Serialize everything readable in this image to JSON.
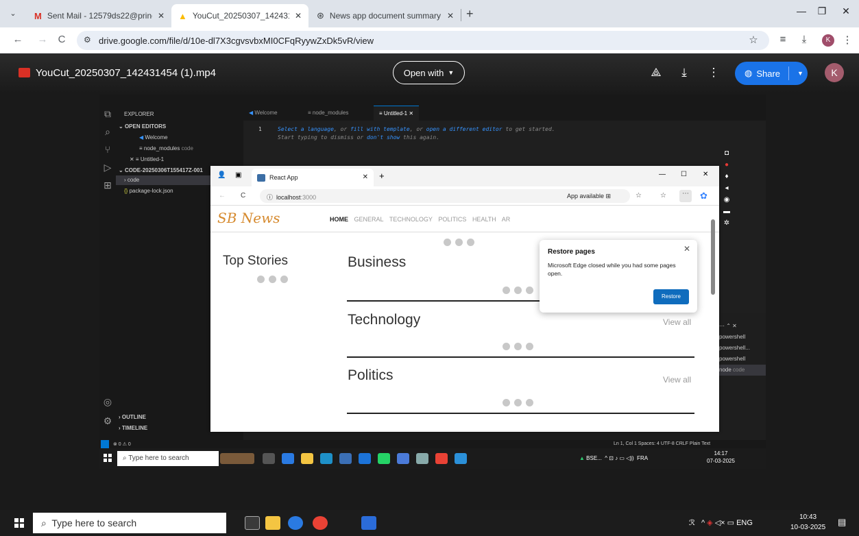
{
  "browser": {
    "tabs": [
      {
        "title": "Sent Mail - 12579ds22@princet",
        "active": false
      },
      {
        "title": "YouCut_20250307_142431454 (",
        "active": true
      },
      {
        "title": "News app document summary",
        "active": false
      }
    ],
    "url": "drive.google.com/file/d/10e-dl7X3cgvsvbxMI0CFqRyywZxDk5vR/view",
    "profile_initial": "K"
  },
  "drive": {
    "file_name": "YouCut_20250307_142431454 (1).mp4",
    "open_with_label": "Open with",
    "share_label": "Share",
    "avatar_initial": "K"
  },
  "vscode": {
    "explorer_title": "EXPLORER",
    "open_editors": "OPEN EDITORS",
    "open_editor_items": [
      "Welcome",
      "node_modules",
      "Untitled-1"
    ],
    "node_modules_suffix": "code",
    "folder": "CODE-20250306T155417Z-001",
    "folder_items": [
      "code",
      "package-lock.json"
    ],
    "outline": "OUTLINE",
    "timeline": "TIMELINE",
    "tabs": [
      "Welcome",
      "node_modules",
      "Untitled-1"
    ],
    "line_number": "1",
    "editor_hint_line1_parts": [
      "Select a language",
      ", or ",
      "fill with template",
      ", or ",
      "open a different editor",
      " to get started."
    ],
    "editor_hint_line2_parts": [
      "Start typing to dismiss or ",
      "don't show",
      " this again."
    ],
    "terminals": [
      "powershell",
      "powershell...",
      "powershell",
      "node"
    ],
    "terminal_node_suffix": "code",
    "status_left": "⊗ 0 ⚠ 0",
    "status_right": "Ln 1, Col 1   Spaces: 4   UTF-8   CRLF   Plain Text"
  },
  "edge": {
    "tab_title": "React App",
    "url_host": "localhost",
    "url_port": ":3000",
    "app_available": "App available",
    "restore": {
      "title": "Restore pages",
      "body": "Microsoft Edge closed while you had some pages open.",
      "button": "Restore"
    }
  },
  "react_app": {
    "brand": "SB News",
    "nav": [
      "HOME",
      "GENERAL",
      "TECHNOLOGY",
      "POLITICS",
      "HEALTH",
      "AR"
    ],
    "top_stories": "Top Stories",
    "sections": [
      {
        "title": "Business",
        "view_all": ""
      },
      {
        "title": "Technology",
        "view_all": "View all"
      },
      {
        "title": "Politics",
        "view_all": "View all"
      }
    ]
  },
  "video_taskbar": {
    "search_placeholder": "Type here to search",
    "tray_text": "BSE...",
    "lang": "FRA",
    "time": "14:17",
    "date": "07-03-2025"
  },
  "taskbar": {
    "search_placeholder": "Type here to search",
    "lang": "ENG",
    "time": "10:43",
    "date": "10-03-2025"
  }
}
